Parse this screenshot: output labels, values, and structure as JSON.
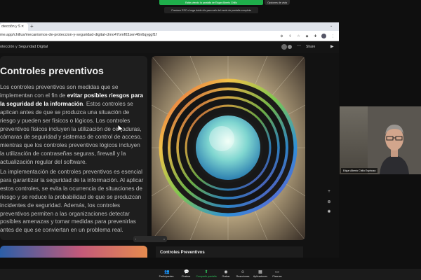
{
  "zoom": {
    "share_banner": "Estás viendo la pantalla de Edgar Alberto Chillo",
    "view_options": "Opciones de vista",
    "esc_hint": "Presione ESC o haga doble clic para salir del modo de pantalla completa",
    "toolbar": [
      {
        "label": "Participantes",
        "icon": "people-icon"
      },
      {
        "label": "Chatear",
        "icon": "chat-icon"
      },
      {
        "label": "Compartir pantalla",
        "icon": "share-screen-icon"
      },
      {
        "label": "Grabar",
        "icon": "record-icon"
      },
      {
        "label": "Reacciones",
        "icon": "smile-icon"
      },
      {
        "label": "Aplicaciones",
        "icon": "apps-icon"
      },
      {
        "label": "Pizarras",
        "icon": "whiteboard-icon"
      }
    ],
    "participant_name": "Edgar Alberto Chillo Espinoza"
  },
  "browser": {
    "tab_title": "otección y S",
    "url": "me.app/chillus/mecanismos-de-proteccion-y-seguridad-digital-clmo47omf03zen46n6qyggf1f"
  },
  "app": {
    "title": "otección y Seguridad Digital",
    "share_label": "Share"
  },
  "slide": {
    "title": "Controles preventivos",
    "para1_a": "Los controles preventivos son medidas que se implementan con el fin de ",
    "para1_b": "evitar posibles riesgos para la seguridad de la información",
    "para1_c": ". Estos controles se aplican antes de que se produzca una situación de riesgo y pueden ser físicos o lógicos. Los controles preventivos físicos incluyen la utilización de cerraduras, cámaras de seguridad y sistemas de control de acceso, mientras que los controles preventivos lógicos incluyen la utilización de contraseñas seguras, firewall y la actualización regular del software.",
    "para2": "La implementación de controles preventivos es esencial para garantizar la seguridad de la información. Al aplicar estos controles, se evita la ocurrencia de situaciones de riesgo y se reduce la probabilidad de que se produzcan incidentes de seguridad. Además, los controles preventivos permiten a las organizaciones detectar posibles amenazas y tomar medidas para prevenirlas antes de que se conviertan en un problema real.",
    "next_title": "Controles Preventivos"
  },
  "colors": {
    "zoom_green": "#1fae4b",
    "slide_bg": "#1e1e1e"
  }
}
